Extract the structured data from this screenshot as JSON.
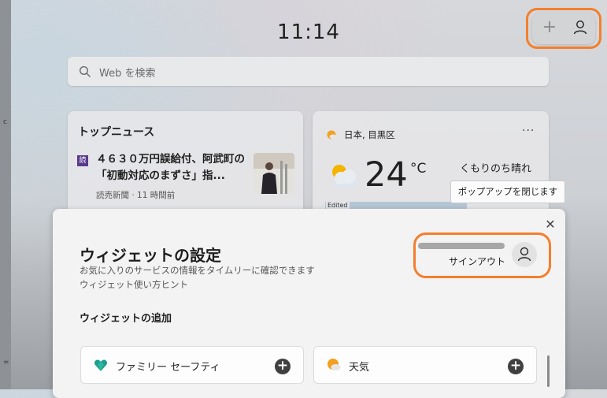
{
  "clock": "11:14",
  "search": {
    "placeholder": "Web を検索"
  },
  "top_actions": {
    "add_label": "+"
  },
  "news": {
    "title": "トップニュース",
    "logo": "読",
    "headline": "４６３０万円誤給付、阿武町の「初動対応のまずさ」指...",
    "source": "読売新聞 · 11 時間前"
  },
  "weather": {
    "location": "日本, 目黒区",
    "more": "···",
    "temperature": "24",
    "unit": "°C",
    "condition": "くもりのち晴れ",
    "map_tag": "Edited"
  },
  "tooltip": "ポップアップを閉じます",
  "panel": {
    "close": "✕",
    "title": "ウィジェットの設定",
    "description": "お気に入りのサービスの情報をタイムリーに確認できます",
    "hint": "ウィジェット使い方ヒント",
    "signout": "サインアウト",
    "section_heading": "ウィジェットの追加",
    "widgets": [
      {
        "label": "ファミリー セーフティ",
        "add": "+"
      },
      {
        "label": "天気",
        "add": "+"
      }
    ]
  },
  "colors": {
    "highlight": "#f47f2c",
    "family_safety": "#1f9d8f",
    "weather_sun": "#f4a021"
  }
}
